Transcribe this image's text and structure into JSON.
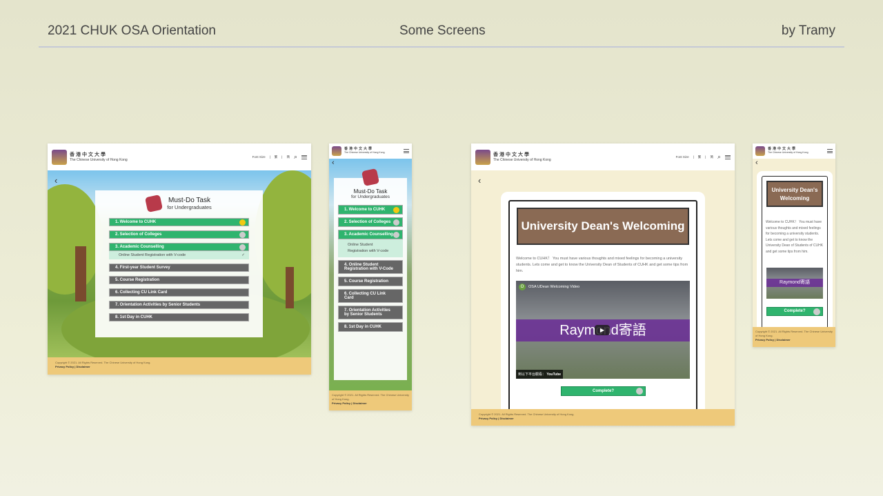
{
  "slide": {
    "left": "2021 CHUK OSA Orientation",
    "center": "Some Screens",
    "right": "by Tramy"
  },
  "site": {
    "name_zh": "香港中文大學",
    "name_en": "The Chinese University of Hong Kong",
    "font_size": "Font Size",
    "trad": "繁",
    "simp": "简",
    "footer_copyright": "Copyright © 2021. All Rights Reserved. The Chinese University of Hong Kong.",
    "footer_links": "Privacy Policy | Disclaimer"
  },
  "mustdo": {
    "title": "Must-Do Task",
    "subtitle": "for Undergraduates",
    "tasks": [
      {
        "label": "1.  Welcome to CUHK",
        "status": "current"
      },
      {
        "label": "2.  Selection of Colleges",
        "status": "open"
      },
      {
        "label": "3.  Academic Counselling",
        "status": "open",
        "sub": "Online Student Registration with V-code"
      },
      {
        "label": "4.  First-year Student Survey",
        "status": "locked"
      },
      {
        "label": "5.  Course Registration",
        "status": "locked"
      },
      {
        "label": "6.  Collecting CU Link Card",
        "status": "locked"
      },
      {
        "label": "7.  Orientation Activities by Senior Students",
        "status": "locked"
      },
      {
        "label": "8.  1st Day in CUHK",
        "status": "locked"
      }
    ],
    "mobile_tasks": [
      {
        "label": "1.  Welcome to CUHK",
        "status": "current"
      },
      {
        "label": "2.  Selection of Colleges",
        "status": "open"
      },
      {
        "label": "3.  Academic Counselling",
        "status": "open",
        "sub": "Online Student Registration with V-code"
      },
      {
        "label": "4.  Online Student Registration with V-Code",
        "status": "locked"
      },
      {
        "label": "5.  Course Registration",
        "status": "locked"
      },
      {
        "label": "6.  Collecting CU Link Card",
        "status": "locked"
      },
      {
        "label": "7.  Orientation Activities by Senior Students",
        "status": "locked"
      },
      {
        "label": "8.  1st Day in CUHK",
        "status": "locked"
      }
    ]
  },
  "dean": {
    "title": "University Dean's Welcoming",
    "body": "Welcome to CUHK！ You must have various thoughts and mixed feelings for becoming a university students. Lets come and get to know the University Dean of Students of CUHK and get some tips from him.",
    "video_title": "OSA UDean Welcoming Video",
    "video_banner": "Raymond寄語",
    "watch_on": "到以下平台觀看：",
    "youtube": "YouTube",
    "complete": "Complete?"
  },
  "colors": {
    "green": "#2fb46e",
    "grey": "#666666",
    "brown": "#8a6a54",
    "footer": "#eec97a"
  }
}
